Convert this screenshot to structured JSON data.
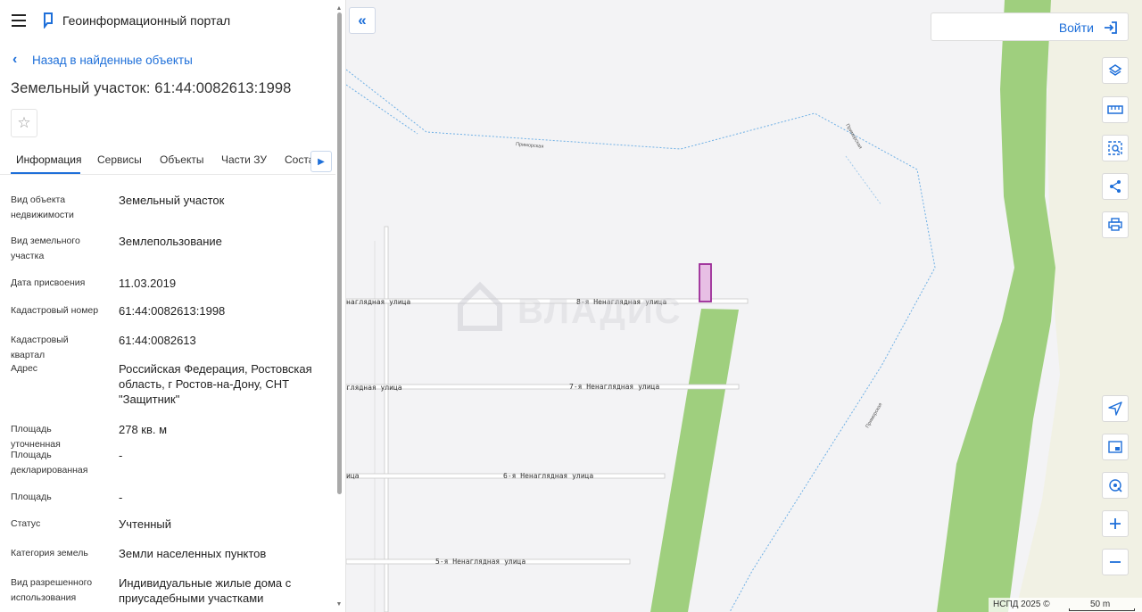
{
  "header": {
    "portal_title": "Геоинформационный портал",
    "back_label": "Назад в найденные объекты"
  },
  "object": {
    "title": "Земельный участок: 61:44:0082613:1998"
  },
  "tabs": [
    {
      "label": "Информация",
      "active": true
    },
    {
      "label": "Сервисы",
      "active": false
    },
    {
      "label": "Объекты",
      "active": false
    },
    {
      "label": "Части ЗУ",
      "active": false
    },
    {
      "label": "Соста",
      "active": false
    }
  ],
  "info": [
    {
      "label": "Вид объекта недвижимости",
      "value": "Земельный участок"
    },
    {
      "label": "Вид земельного участка",
      "value": "Землепользование"
    },
    {
      "label": "Дата присвоения",
      "value": "11.03.2019"
    },
    {
      "label": "Кадастровый номер",
      "value": "61:44:0082613:1998"
    },
    {
      "label": "Кадастровый квартал",
      "value": "61:44:0082613"
    },
    {
      "label": "Адрес",
      "value": "Российская Федерация, Ростовская область, г Ростов-на-Дону, СНТ \"Защитник\""
    },
    {
      "label": "Площадь уточненная",
      "value": "278 кв. м"
    },
    {
      "label": "Площадь декларированная",
      "value": "-"
    },
    {
      "label": "Площадь",
      "value": "-"
    },
    {
      "label": "Статус",
      "value": "Учтенный"
    },
    {
      "label": "Категория земель",
      "value": "Земли населенных пунктов"
    },
    {
      "label": "Вид разрешенного использования",
      "value": "Индивидуальные жилые дома с приусадебными участками"
    }
  ],
  "map": {
    "login_label": "Войти",
    "streets": {
      "s8": "8-я Ненаглядная улица",
      "s8_left": "наглядная улица",
      "s7": "7-я Ненаглядная улица",
      "s7_left": "глядная улица",
      "s6": "6-я Ненаглядная улица",
      "s6_left": "ица",
      "s5": "5-я Ненаглядная улица"
    },
    "minor_label": "Приморская",
    "watermark": "ВЛАДИС",
    "attribution": "НСПД 2025 ©",
    "scale": "50 m",
    "parcel_color": "#e7bfe4",
    "parcel_stroke": "#9b2a97",
    "green_color": "#9fcf7e"
  },
  "tools": [
    "layers-icon",
    "ruler-icon",
    "select-area-icon",
    "share-icon",
    "print-icon",
    "locate-icon",
    "minimap-icon",
    "marker-icon",
    "zoom-in-icon",
    "zoom-out-icon"
  ]
}
